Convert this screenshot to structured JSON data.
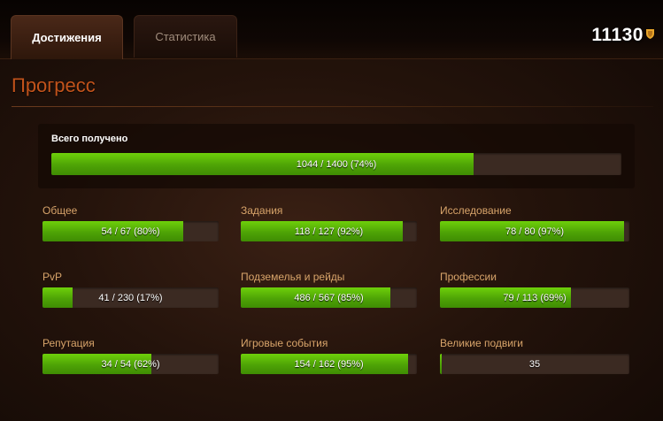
{
  "tabs": {
    "achievements": "Достижения",
    "statistics": "Статистика"
  },
  "points": "11130",
  "section_title": "Прогресс",
  "total": {
    "label": "Всего получено",
    "text": "1044 / 1400 (74%)",
    "fraction": 0.74
  },
  "categories": [
    {
      "label": "Общее",
      "text": "54 / 67 (80%)",
      "fraction": 0.8
    },
    {
      "label": "Задания",
      "text": "118 / 127 (92%)",
      "fraction": 0.92
    },
    {
      "label": "Исследование",
      "text": "78 / 80 (97%)",
      "fraction": 0.97
    },
    {
      "label": "PvP",
      "text": "41 / 230 (17%)",
      "fraction": 0.17
    },
    {
      "label": "Подземелья и рейды",
      "text": "486 / 567 (85%)",
      "fraction": 0.85
    },
    {
      "label": "Профессии",
      "text": "79 / 113 (69%)",
      "fraction": 0.69
    },
    {
      "label": "Репутация",
      "text": "34 / 54 (62%)",
      "fraction": 0.62
    },
    {
      "label": "Игровые события",
      "text": "154 / 162 (95%)",
      "fraction": 0.95
    },
    {
      "label": "Великие подвиги",
      "text": "35",
      "fraction": 0.01
    }
  ],
  "colors": {
    "accent": "#c2531b",
    "progress_green": "#4ea306",
    "label": "#d8a46a",
    "points_shield": "#e8a52a"
  }
}
